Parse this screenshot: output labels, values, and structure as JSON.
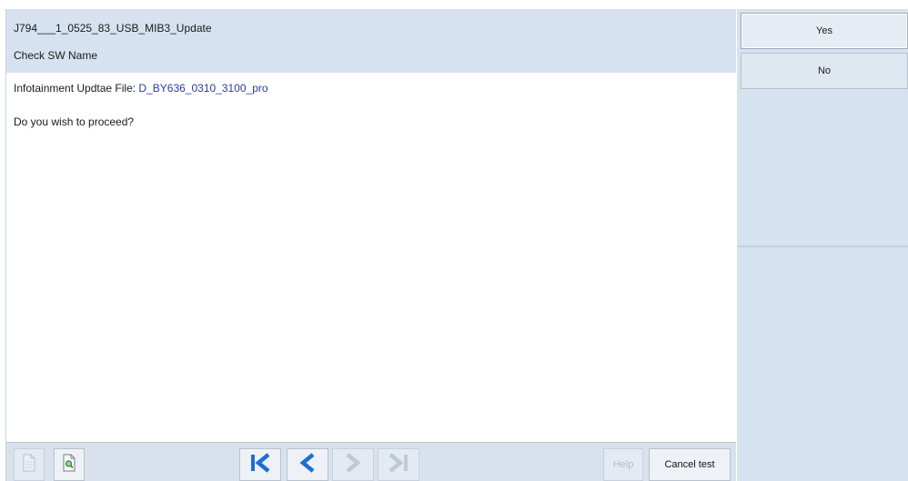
{
  "header": {
    "title": "J794___1_0525_83_USB_MIB3_Update",
    "subtitle": "Check SW Name"
  },
  "content": {
    "file_label": "Infotainment Updtae File:",
    "file_value": "D_BY636_0310_3100_pro",
    "question": "Do you wish to proceed?"
  },
  "actions": {
    "yes_label": "Yes",
    "no_label": "No"
  },
  "toolbar": {
    "help_label": "Help",
    "cancel_label": "Cancel test",
    "icons": [
      "document-icon",
      "document-search-icon",
      "first-page-icon",
      "previous-icon",
      "next-icon",
      "last-page-icon"
    ]
  },
  "colors": {
    "header_bg": "#d6e2f0",
    "side_bg": "#d6e2f0",
    "nav_blue": "#1d6fd1",
    "file_value_color": "#2a3da0"
  }
}
